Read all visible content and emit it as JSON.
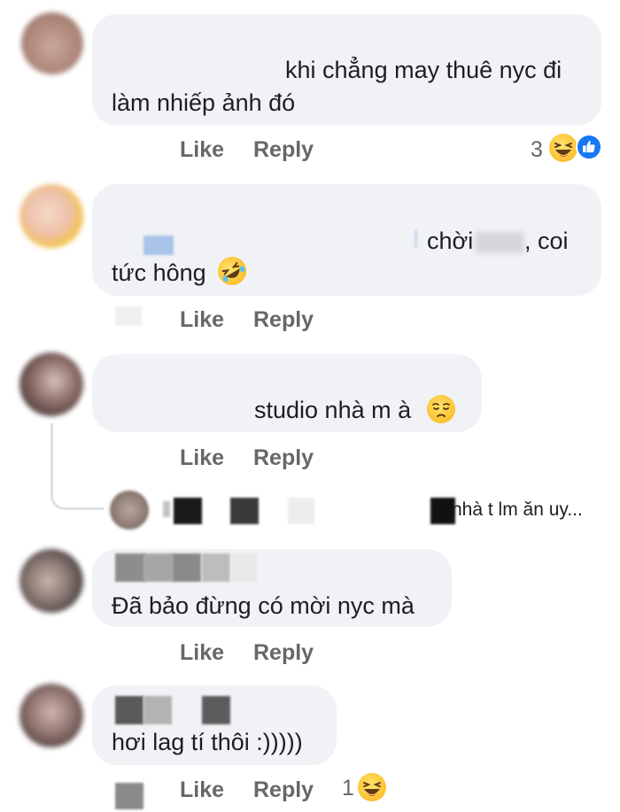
{
  "comments": [
    {
      "line1": "khi  chẳng may thuê nyc đi",
      "line2": "làm nhiếp ảnh đó",
      "like_label": "Like",
      "reply_label": "Reply",
      "reaction_count": "3",
      "reactions": [
        "laughing-emoji",
        "like-thumb"
      ]
    },
    {
      "line1_suffix": ", coi",
      "line1_mid": "chời",
      "line2": "tức hông",
      "line2_emoji": "rofl-emoji",
      "like_label": "Like",
      "reply_label": "Reply"
    },
    {
      "line1": "studio nhà m à",
      "line1_emoji": "pensive-emoji",
      "like_label": "Like",
      "reply_label": "Reply",
      "reply_preview": "nhà t lm ăn uy..."
    },
    {
      "line1": "Đã bảo đừng có mời nyc mà",
      "like_label": "Like",
      "reply_label": "Reply"
    },
    {
      "line1": "hơi lag tí thôi :)))))",
      "like_label": "Like",
      "reply_label": "Reply",
      "reaction_count": "1",
      "reactions": [
        "laughing-emoji"
      ]
    }
  ],
  "colors": {
    "bubble": "#f0f2f5",
    "text": "#1c1e21",
    "secondary": "#65676b",
    "like_blue": "#1877f2",
    "emoji_yellow": "#fbc02d"
  }
}
